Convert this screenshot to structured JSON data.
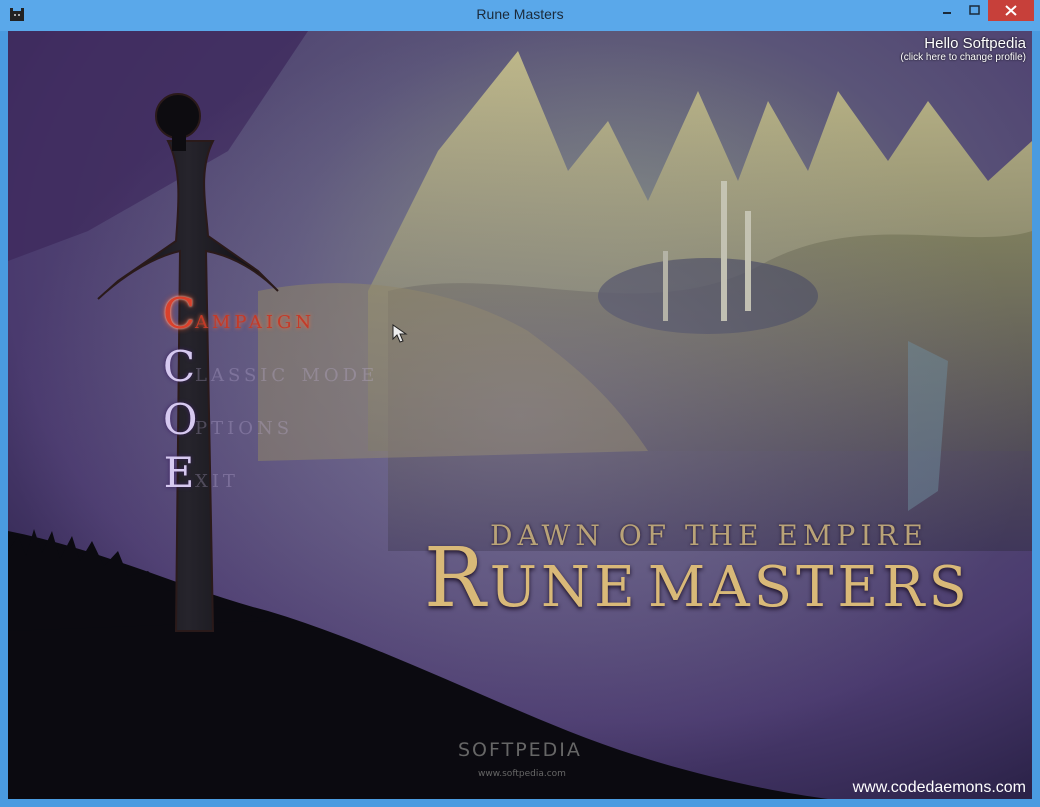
{
  "window": {
    "title": "Rune Masters",
    "app_icon": "game-icon",
    "controls": [
      "minimize-icon",
      "maximize-icon",
      "close-icon"
    ]
  },
  "profile": {
    "greeting": "Hello Softpedia",
    "hint": "(click here to change profile)"
  },
  "menu": {
    "items": [
      {
        "initial": "C",
        "rest": "ampaign",
        "active": true
      },
      {
        "initial": "C",
        "rest": "lassic mode",
        "active": false
      },
      {
        "initial": "O",
        "rest": "ptions",
        "active": false
      },
      {
        "initial": "E",
        "rest": "xit",
        "active": false
      }
    ]
  },
  "logo": {
    "subtitle": "DAWN OF THE EMPIRE",
    "title_r": "R",
    "title_une": "UNE",
    "title_masters": "MASTERS"
  },
  "watermark": {
    "brand": "SOFTPEDIA",
    "url": "www.softpedia.com"
  },
  "footer": {
    "site": "www.codedaemons.com"
  },
  "colors": {
    "titlebar": "#5aa8ea",
    "close": "#c7403a",
    "active_menu": "#d9412c",
    "logo_gold": "#d9b978"
  }
}
